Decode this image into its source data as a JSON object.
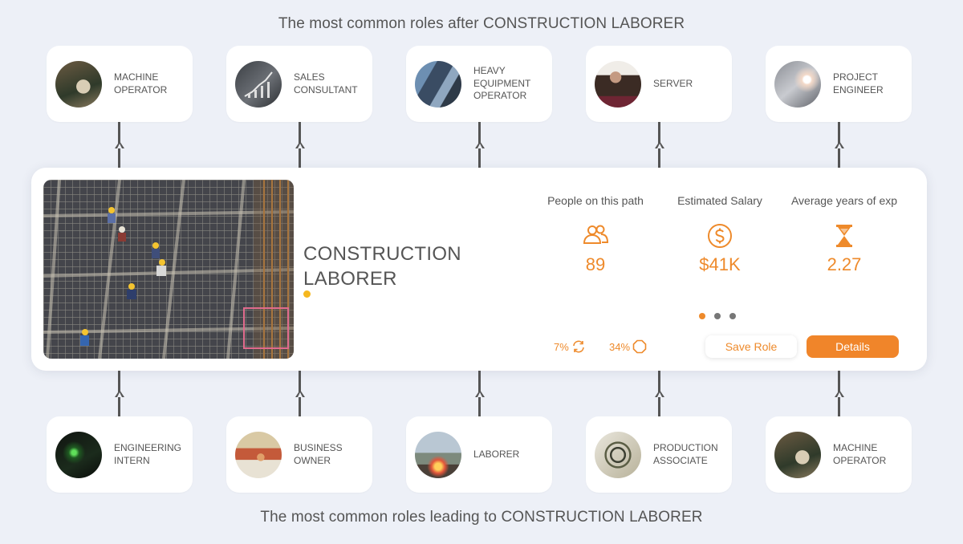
{
  "headings": {
    "top": "The most common roles after CONSTRUCTION LABORER",
    "bottom": "The most common roles leading to CONSTRUCTION LABORER"
  },
  "next_roles": [
    {
      "name": "MACHINE OPERATOR",
      "image": "machine-operator-photo"
    },
    {
      "name": "SALES CONSULTANT",
      "image": "sales-chart-photo"
    },
    {
      "name": "HEAVY EQUIPMENT OPERATOR",
      "image": "excavator-photo"
    },
    {
      "name": "SERVER",
      "image": "server-photo"
    },
    {
      "name": "PROJECT ENGINEER",
      "image": "welding-sparks-photo"
    }
  ],
  "previous_roles": [
    {
      "name": "ENGINEERING INTERN",
      "image": "laser-lab-photo"
    },
    {
      "name": "BUSINESS OWNER",
      "image": "shop-owner-photo"
    },
    {
      "name": "LABORER",
      "image": "site-fire-photo"
    },
    {
      "name": "PRODUCTION ASSOCIATE",
      "image": "cable-reel-photo"
    },
    {
      "name": "MACHINE OPERATOR",
      "image": "machine-operator-photo"
    }
  ],
  "current_role": {
    "title": "CONSTRUCTION LABORER",
    "image": "rebar-workers-photo",
    "stats": [
      {
        "label": "People on this path",
        "value": "89",
        "icon": "people-icon"
      },
      {
        "label": "Estimated Salary",
        "value": "$41K",
        "icon": "dollar-icon"
      },
      {
        "label": "Average years of exp",
        "value": "2.27",
        "icon": "hourglass-icon"
      }
    ],
    "metric_a": "7%",
    "metric_b": "34%",
    "pager": {
      "count": 3,
      "active": 1
    },
    "save_label": "Save Role",
    "details_label": "Details"
  },
  "colors": {
    "accent": "#f0852a",
    "background": "#edf0f7",
    "dot": "#f5b71f"
  }
}
